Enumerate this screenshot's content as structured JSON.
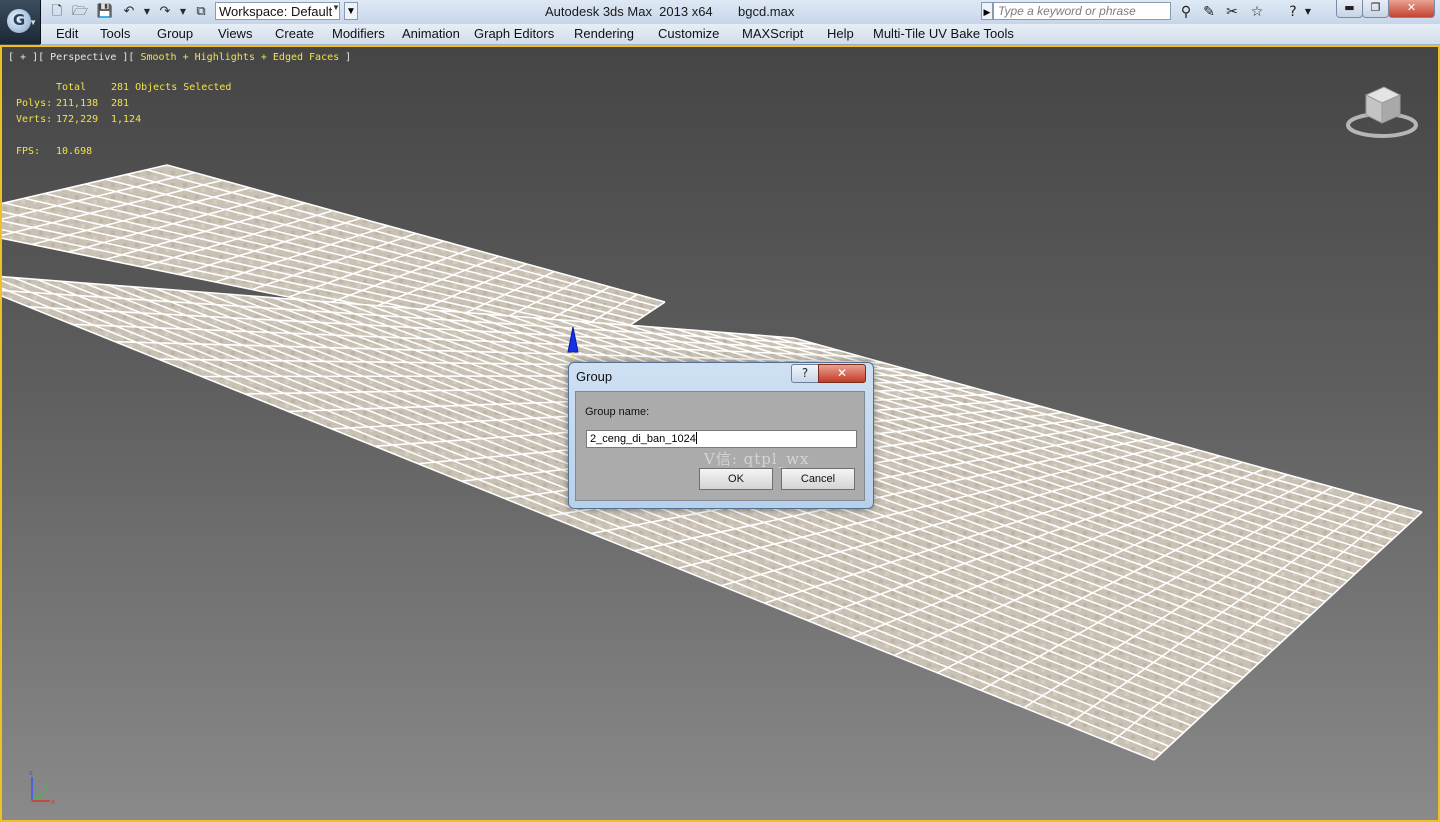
{
  "titlebar": {
    "app_menu_icon": "3dsmax-logo-icon",
    "workspace": "Workspace: Default",
    "app_title": "Autodesk 3ds Max  2013 x64",
    "file_name": "bgcd.max",
    "search_placeholder": "Type a keyword or phrase"
  },
  "menu": [
    "Edit",
    "Tools",
    "Group",
    "Views",
    "Create",
    "Modifiers",
    "Animation",
    "Graph Editors",
    "Rendering",
    "Customize",
    "MAXScript",
    "Help",
    "Multi-Tile UV Bake Tools"
  ],
  "viewport": {
    "label_plain": "[ + ][ Perspective ][ ",
    "label_shading": "Smooth + Highlights + Edged Faces",
    "label_end": " ]",
    "stats": {
      "header_total": "Total",
      "header_selected": "281 Objects Selected",
      "polys_label": "Polys:",
      "polys_total": "211,138",
      "polys_selected": "281",
      "verts_label": "Verts:",
      "verts_total": "172,229",
      "verts_selected": "1,124",
      "fps_label": "FPS:",
      "fps_value": "10.698"
    },
    "gizmo_axes": [
      "z",
      "y",
      "x"
    ]
  },
  "dialog": {
    "title": "Group",
    "help": "?",
    "close": "✕",
    "group_name_label": "Group name:",
    "group_name_value": "2_ceng_di_ban_1024",
    "watermark": "V信: qtpl_wx",
    "ok": "OK",
    "cancel": "Cancel"
  },
  "colors": {
    "viewport_border": "#f0c020",
    "stats_text": "#f2e24a",
    "tile_fill": "#c9c1b3",
    "tile_grout": "#ffffff"
  }
}
